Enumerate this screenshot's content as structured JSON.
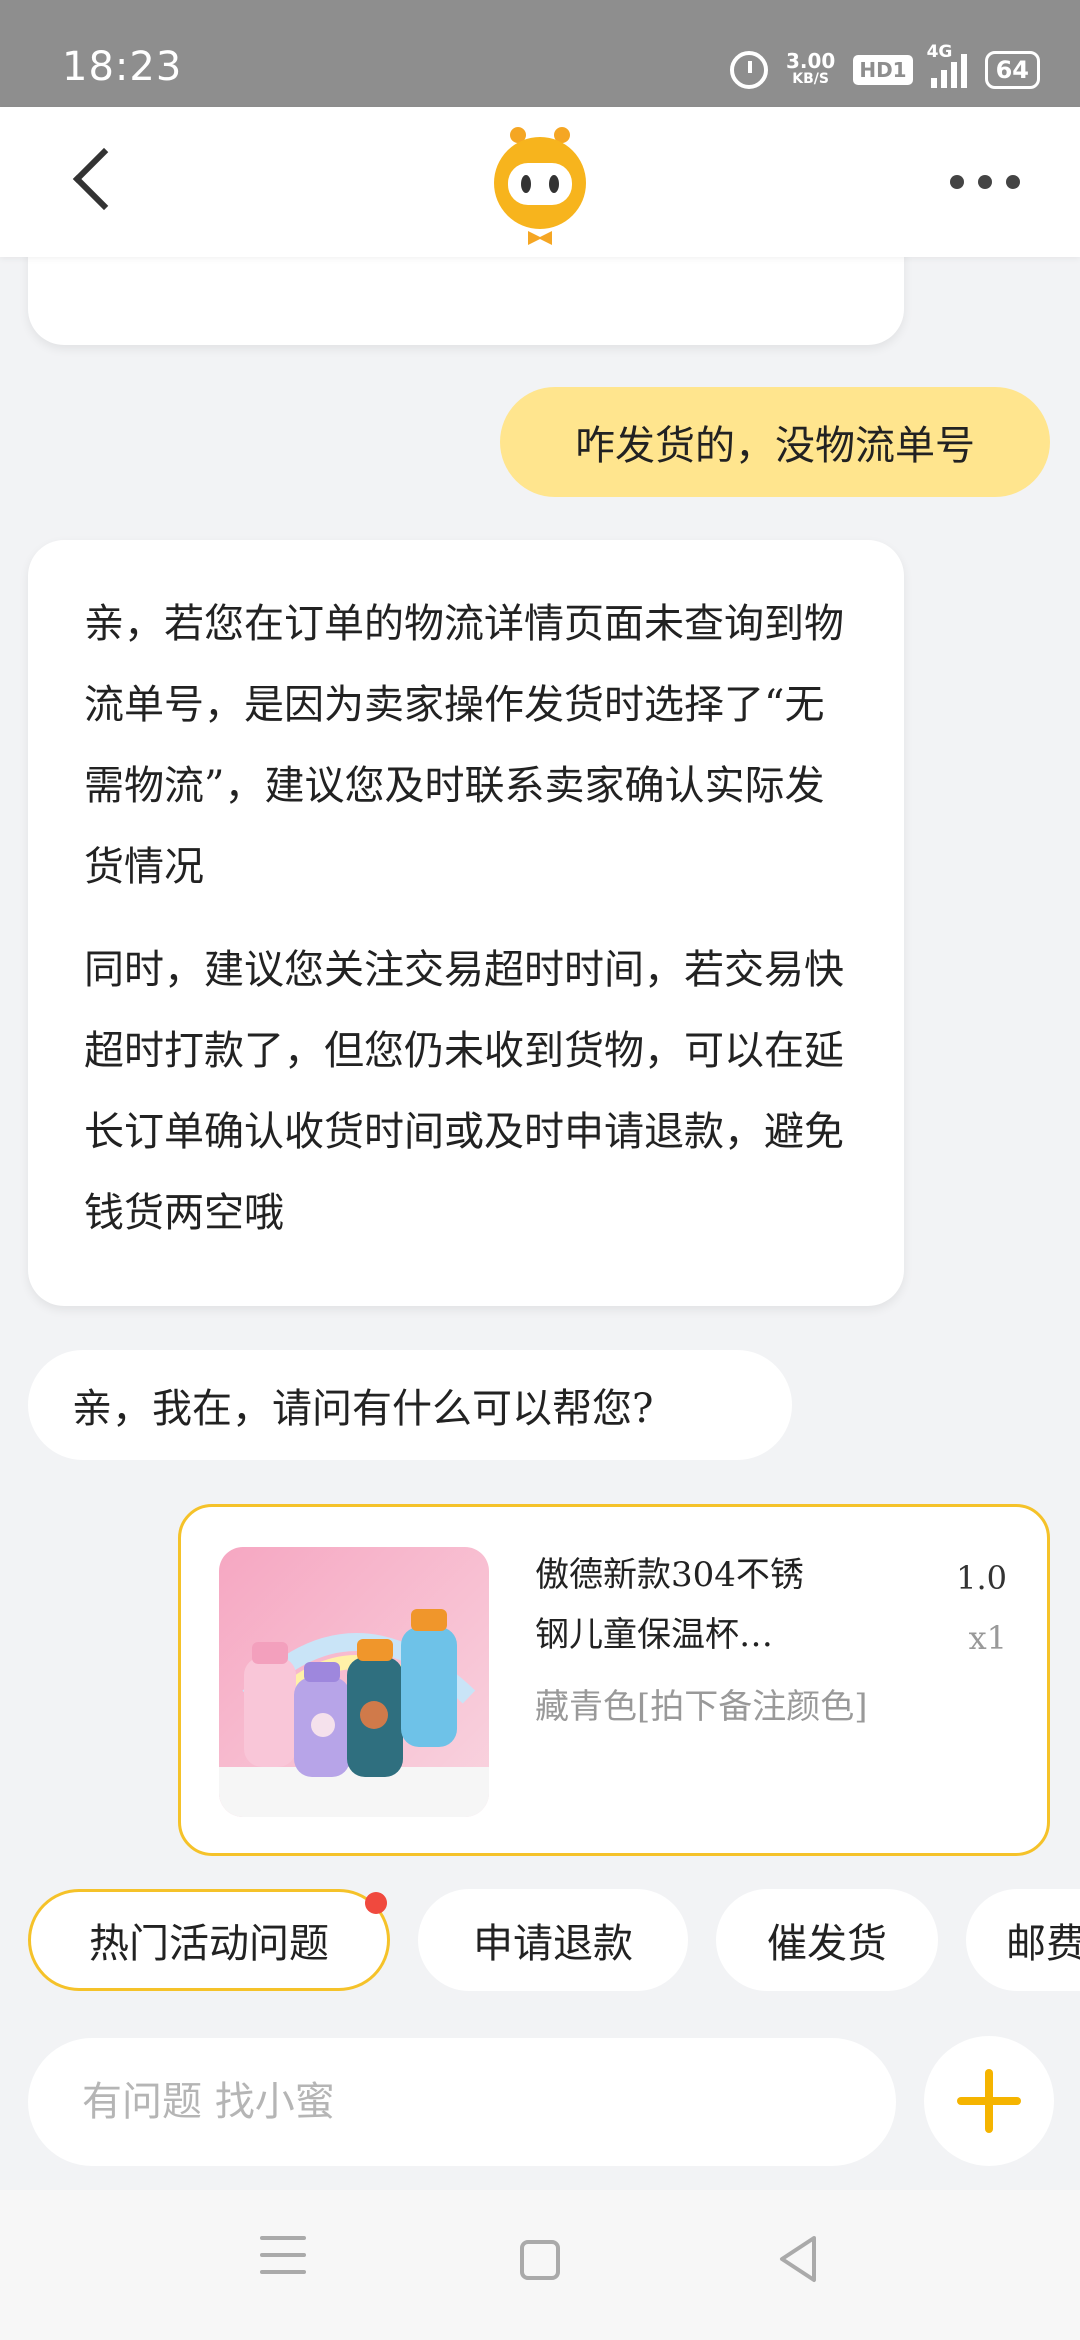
{
  "status_bar": {
    "time": "18:23",
    "net_speed_value": "3.00",
    "net_speed_unit": "KB/S",
    "hd": "HD1",
    "network": "4G",
    "battery": "64",
    "icons": [
      "alarm-icon",
      "signal-icon",
      "battery-icon"
    ]
  },
  "header": {
    "back_icon": "back-icon",
    "logo": "mascot-logo",
    "more_icon": "more-icon"
  },
  "chat": {
    "user_message": "咋发货的，没物流单号",
    "answer_paragraphs": [
      "亲，若您在订单的物流详情页面未查询到物流单号，是因为卖家操作发货时选择了“无需物流”，建议您及时联系卖家确认实际发货情况",
      "同时，建议您关注交易超时时间，若交易快超时打款了，但您仍未收到货物，可以在延长订单确认收货时间或及时申请退款，避免钱货两空哦"
    ],
    "greeting": "亲，我在，请问有什么可以帮您?"
  },
  "product": {
    "title": "傲德新款304不锈钢儿童保温杯…",
    "spec": "藏青色[拍下备注颜色]",
    "price": "1.0",
    "quantity": "x1"
  },
  "quick_replies": [
    {
      "label": "热门活动问题",
      "active": true,
      "has_dot": true
    },
    {
      "label": "申请退款",
      "active": false
    },
    {
      "label": "催发货",
      "active": false
    },
    {
      "label": "邮费",
      "active": false
    }
  ],
  "input": {
    "placeholder": "有问题 找小蜜"
  },
  "colors": {
    "accent": "#f5c229",
    "user_bubble": "#ffe58e",
    "status_bar": "#8e8e8e",
    "background": "#f2f3f5",
    "badge_dot": "#f0493e"
  }
}
